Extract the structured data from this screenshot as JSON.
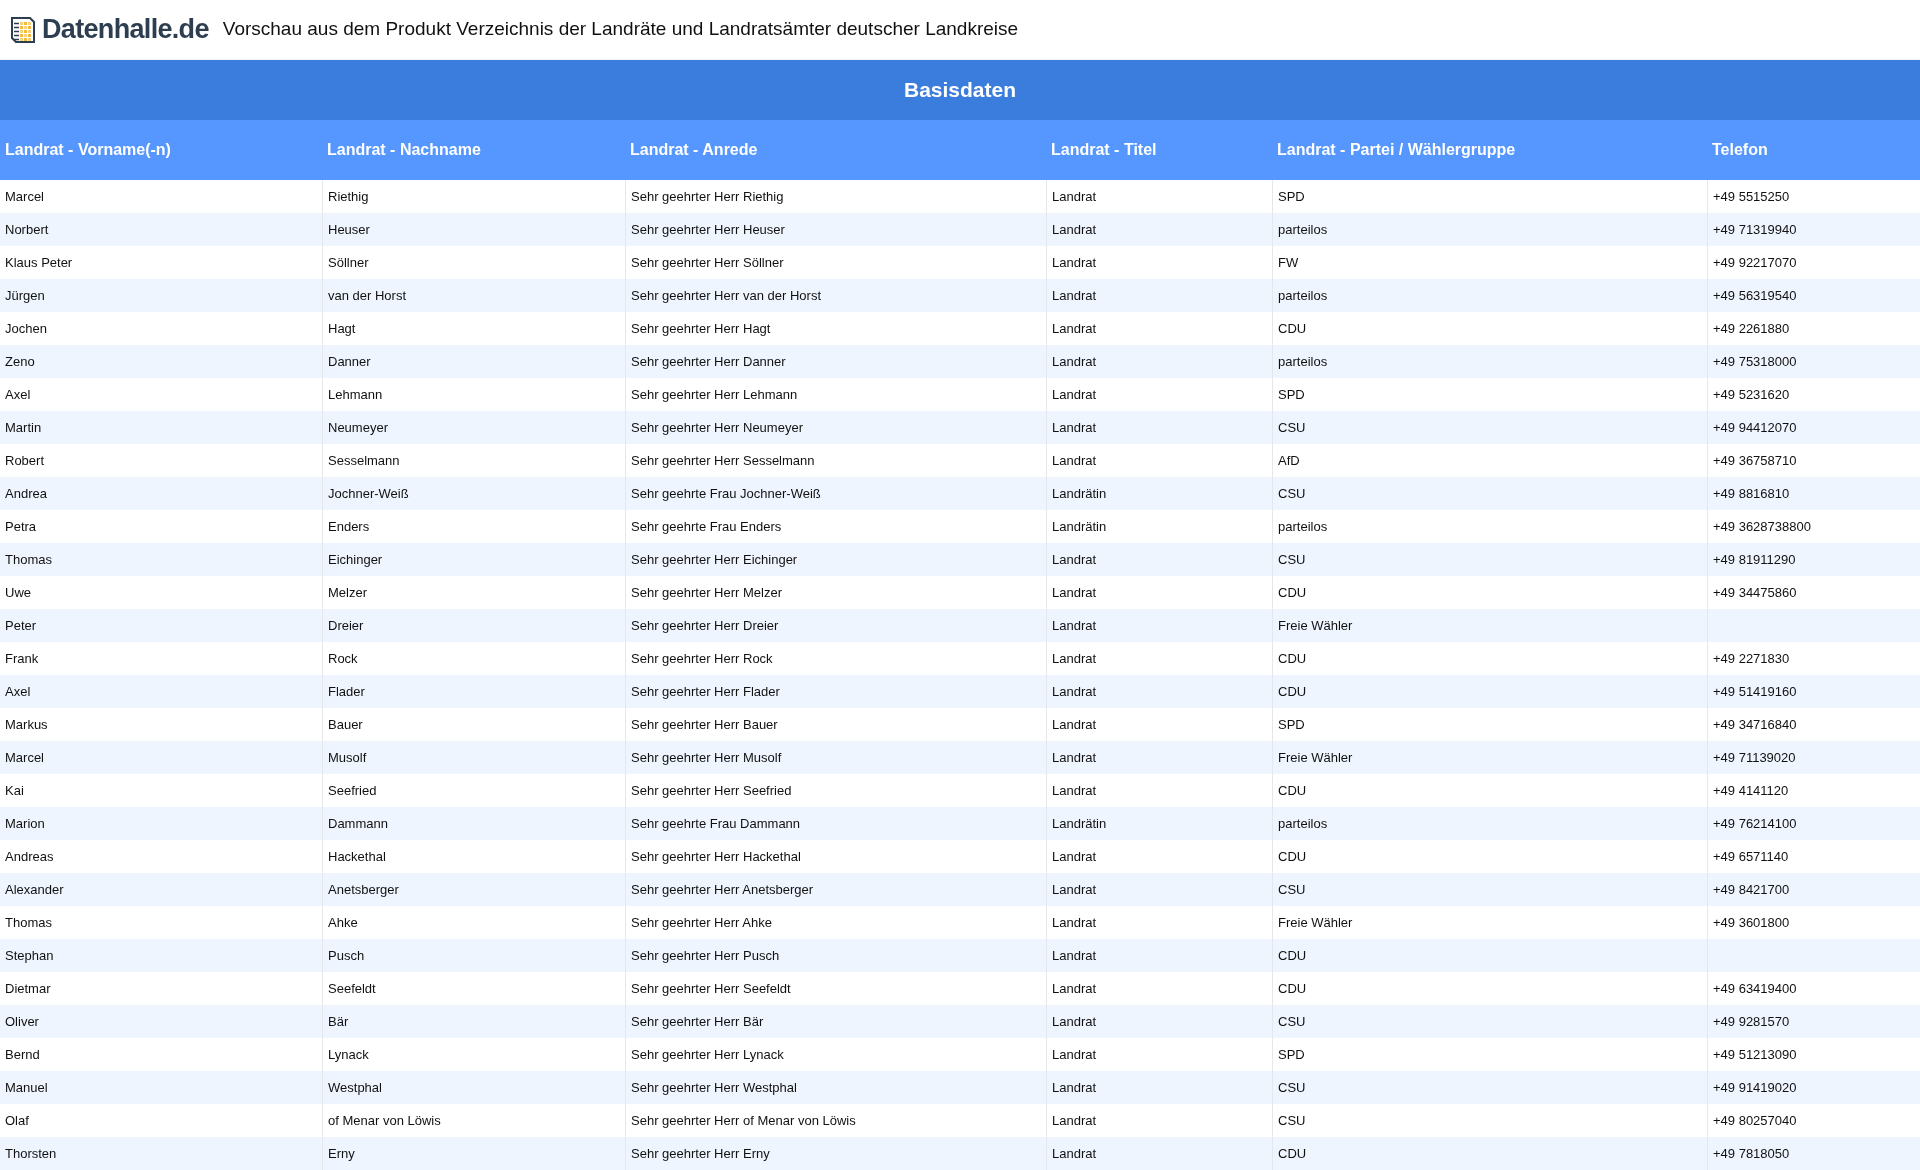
{
  "header": {
    "logo_text": "Datenhalle.de",
    "title": "Vorschau aus dem Produkt Verzeichnis der Landräte und Landratsämter deutscher Landkreise"
  },
  "section_title": "Basisdaten",
  "table": {
    "columns": [
      "Landrat - Vorname(-n)",
      "Landrat - Nachname",
      "Landrat - Anrede",
      "Landrat - Titel",
      "Landrat - Partei / Wählergruppe",
      "Telefon"
    ],
    "rows": [
      {
        "first": "Marcel",
        "last": "Riethig",
        "salutation": "Sehr geehrter Herr Riethig",
        "title": "Landrat",
        "party": "SPD",
        "phone": "+49 5515250"
      },
      {
        "first": "Norbert",
        "last": "Heuser",
        "salutation": "Sehr geehrter Herr Heuser",
        "title": "Landrat",
        "party": "parteilos",
        "phone": "+49 71319940"
      },
      {
        "first": "Klaus Peter",
        "last": "Söllner",
        "salutation": "Sehr geehrter Herr Söllner",
        "title": "Landrat",
        "party": "FW",
        "phone": "+49 92217070"
      },
      {
        "first": "Jürgen",
        "last": "van der Horst",
        "salutation": "Sehr geehrter Herr van der Horst",
        "title": "Landrat",
        "party": "parteilos",
        "phone": "+49 56319540"
      },
      {
        "first": "Jochen",
        "last": "Hagt",
        "salutation": "Sehr geehrter Herr Hagt",
        "title": "Landrat",
        "party": "CDU",
        "phone": "+49 2261880"
      },
      {
        "first": "Zeno",
        "last": "Danner",
        "salutation": "Sehr geehrter Herr Danner",
        "title": "Landrat",
        "party": "parteilos",
        "phone": "+49 75318000"
      },
      {
        "first": "Axel",
        "last": "Lehmann",
        "salutation": "Sehr geehrter Herr Lehmann",
        "title": "Landrat",
        "party": "SPD",
        "phone": "+49 5231620"
      },
      {
        "first": "Martin",
        "last": "Neumeyer",
        "salutation": "Sehr geehrter Herr Neumeyer",
        "title": "Landrat",
        "party": "CSU",
        "phone": "+49 94412070"
      },
      {
        "first": "Robert",
        "last": "Sesselmann",
        "salutation": "Sehr geehrter Herr Sesselmann",
        "title": "Landrat",
        "party": "AfD",
        "phone": "+49 36758710"
      },
      {
        "first": "Andrea",
        "last": "Jochner-Weiß",
        "salutation": "Sehr geehrte Frau Jochner-Weiß",
        "title": "Landrätin",
        "party": "CSU",
        "phone": "+49 8816810"
      },
      {
        "first": "Petra",
        "last": "Enders",
        "salutation": "Sehr geehrte Frau Enders",
        "title": "Landrätin",
        "party": "parteilos",
        "phone": "+49 3628738800"
      },
      {
        "first": "Thomas",
        "last": "Eichinger",
        "salutation": "Sehr geehrter Herr Eichinger",
        "title": "Landrat",
        "party": "CSU",
        "phone": "+49 81911290"
      },
      {
        "first": "Uwe",
        "last": "Melzer",
        "salutation": "Sehr geehrter Herr Melzer",
        "title": "Landrat",
        "party": "CDU",
        "phone": "+49 34475860"
      },
      {
        "first": "Peter",
        "last": "Dreier",
        "salutation": "Sehr geehrter Herr Dreier",
        "title": "Landrat",
        "party": "Freie Wähler"
      },
      {
        "first": "Frank",
        "last": "Rock",
        "salutation": "Sehr geehrter Herr Rock",
        "title": "Landrat",
        "party": "CDU",
        "phone": "+49 2271830"
      },
      {
        "first": "Axel",
        "last": "Flader",
        "salutation": "Sehr geehrter Herr Flader",
        "title": "Landrat",
        "party": "CDU",
        "phone": "+49 51419160"
      },
      {
        "first": "Markus",
        "last": "Bauer",
        "salutation": "Sehr geehrter Herr Bauer",
        "title": "Landrat",
        "party": "SPD",
        "phone": "+49 34716840"
      },
      {
        "first": "Marcel",
        "last": "Musolf",
        "salutation": "Sehr geehrter Herr Musolf",
        "title": "Landrat",
        "party": "Freie Wähler",
        "phone": "+49 71139020"
      },
      {
        "first": "Kai",
        "last": "Seefried",
        "salutation": "Sehr geehrter Herr Seefried",
        "title": "Landrat",
        "party": "CDU",
        "phone": "+49 4141120"
      },
      {
        "first": "Marion",
        "last": "Dammann",
        "salutation": "Sehr geehrte Frau Dammann",
        "title": "Landrätin",
        "party": "parteilos",
        "phone": "+49 76214100"
      },
      {
        "first": "Andreas",
        "last": "Hackethal",
        "salutation": "Sehr geehrter Herr Hackethal",
        "title": "Landrat",
        "party": "CDU",
        "phone": "+49 6571140"
      },
      {
        "first": "Alexander",
        "last": "Anetsberger",
        "salutation": "Sehr geehrter Herr Anetsberger",
        "title": "Landrat",
        "party": "CSU",
        "phone": "+49 8421700"
      },
      {
        "first": "Thomas",
        "last": "Ahke",
        "salutation": "Sehr geehrter Herr Ahke",
        "title": "Landrat",
        "party": "Freie Wähler",
        "phone": "+49 3601800"
      },
      {
        "first": "Stephan",
        "last": "Pusch",
        "salutation": "Sehr geehrter Herr Pusch",
        "title": "Landrat",
        "party": "CDU"
      },
      {
        "first": "Dietmar",
        "last": "Seefeldt",
        "salutation": "Sehr geehrter Herr Seefeldt",
        "title": "Landrat",
        "party": "CDU",
        "phone": "+49 63419400"
      },
      {
        "first": "Oliver",
        "last": "Bär",
        "salutation": "Sehr geehrter Herr Bär",
        "title": "Landrat",
        "party": "CSU",
        "phone": "+49 9281570"
      },
      {
        "first": "Bernd",
        "last": "Lynack",
        "salutation": "Sehr geehrter Herr Lynack",
        "title": "Landrat",
        "party": "SPD",
        "phone": "+49 51213090"
      },
      {
        "first": "Manuel",
        "last": "Westphal",
        "salutation": "Sehr geehrter Herr Westphal",
        "title": "Landrat",
        "party": "CSU",
        "phone": "+49 91419020"
      },
      {
        "first": "Olaf",
        "last": "of Menar von Löwis",
        "salutation": "Sehr geehrter Herr of Menar von Löwis",
        "title": "Landrat",
        "party": "CSU",
        "phone": "+49 80257040"
      },
      {
        "first": "Thorsten",
        "last": "Erny",
        "salutation": "Sehr geehrter Herr Erny",
        "title": "Landrat",
        "party": "CDU",
        "phone": "+49 7818050"
      }
    ]
  }
}
